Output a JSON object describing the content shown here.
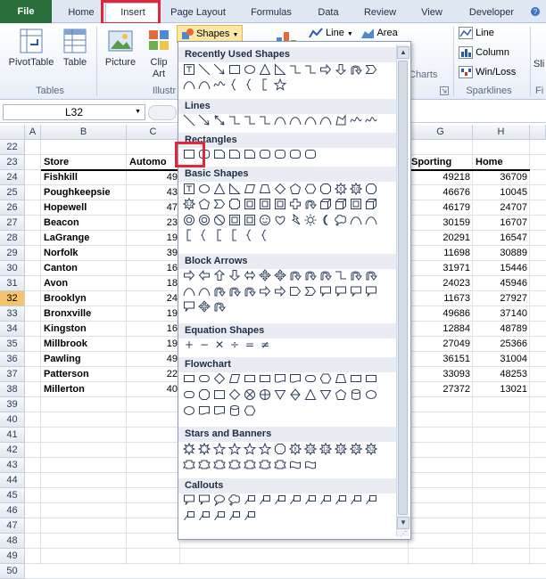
{
  "ribbon_tabs": {
    "file": "File",
    "home": "Home",
    "insert": "Insert",
    "page_layout": "Page Layout",
    "formulas": "Formulas",
    "data": "Data",
    "review": "Review",
    "view": "View",
    "developer": "Developer"
  },
  "ribbon": {
    "pivottable": "PivotTable",
    "table": "Table",
    "tables_group": "Tables",
    "picture": "Picture",
    "clip_art": "Clip Art",
    "illustrations_group": "Illustr",
    "shapes": "Shapes",
    "line": "Line",
    "area": "Area",
    "charts": "Charts",
    "spark_line": "Line",
    "spark_column": "Column",
    "spark_winloss": "Win/Loss",
    "sparklines_group": "Sparklines",
    "slicer_partial": "Sli",
    "filter_partial": "Fi"
  },
  "name_box": "L32",
  "gallery": {
    "sections": [
      "Recently Used Shapes",
      "Lines",
      "Rectangles",
      "Basic Shapes",
      "Block Arrows",
      "Equation Shapes",
      "Flowchart",
      "Stars and Banners",
      "Callouts"
    ],
    "eq_symbols": [
      "+",
      "−",
      "✕",
      "÷",
      "=",
      "≠"
    ],
    "num_stars": [
      "8",
      "10",
      "12",
      "16",
      "24",
      "32"
    ]
  },
  "columns": [
    "A",
    "B",
    "C",
    "G",
    "H"
  ],
  "rows": [
    "22",
    "23",
    "24",
    "25",
    "26",
    "27",
    "28",
    "29",
    "30",
    "31",
    "32",
    "33",
    "34",
    "35",
    "36",
    "37",
    "38",
    "39",
    "40",
    "41",
    "42",
    "43",
    "44",
    "45",
    "46",
    "47",
    "48",
    "49",
    "50"
  ],
  "selected_row": "32",
  "table": {
    "headers": {
      "store": "Store",
      "automotive": "Automo",
      "sporting": "Sporting",
      "home": "Home"
    },
    "rows": [
      {
        "store": "Fishkill",
        "auto": "49",
        "sporting": "49218",
        "home": "36709"
      },
      {
        "store": "Poughkeepsie",
        "auto": "43",
        "sporting": "46676",
        "home": "10045"
      },
      {
        "store": "Hopewell",
        "auto": "47",
        "sporting": "46179",
        "home": "24707"
      },
      {
        "store": "Beacon",
        "auto": "23",
        "sporting": "30159",
        "home": "16707"
      },
      {
        "store": "LaGrange",
        "auto": "19",
        "sporting": "20291",
        "home": "16547"
      },
      {
        "store": "Norfolk",
        "auto": "39",
        "sporting": "11698",
        "home": "30889"
      },
      {
        "store": "Canton",
        "auto": "16",
        "sporting": "31971",
        "home": "15446"
      },
      {
        "store": "Avon",
        "auto": "18",
        "sporting": "24023",
        "home": "45946"
      },
      {
        "store": "Brooklyn",
        "auto": "24",
        "sporting": "11673",
        "home": "27927"
      },
      {
        "store": "Bronxville",
        "auto": "19",
        "sporting": "49686",
        "home": "37140"
      },
      {
        "store": "Kingston",
        "auto": "16",
        "sporting": "12884",
        "home": "48789"
      },
      {
        "store": "Millbrook",
        "auto": "19",
        "sporting": "27049",
        "home": "25366"
      },
      {
        "store": "Pawling",
        "auto": "49",
        "sporting": "36151",
        "home": "31004"
      },
      {
        "store": "Patterson",
        "auto": "22",
        "sporting": "33093",
        "home": "48253"
      },
      {
        "store": "Millerton",
        "auto": "40",
        "sporting": "27372",
        "home": "13021"
      }
    ]
  },
  "colors": {
    "file_green": "#2a6f3b",
    "highlight_red": "#e0273a",
    "row_select": "#f5c46a"
  }
}
